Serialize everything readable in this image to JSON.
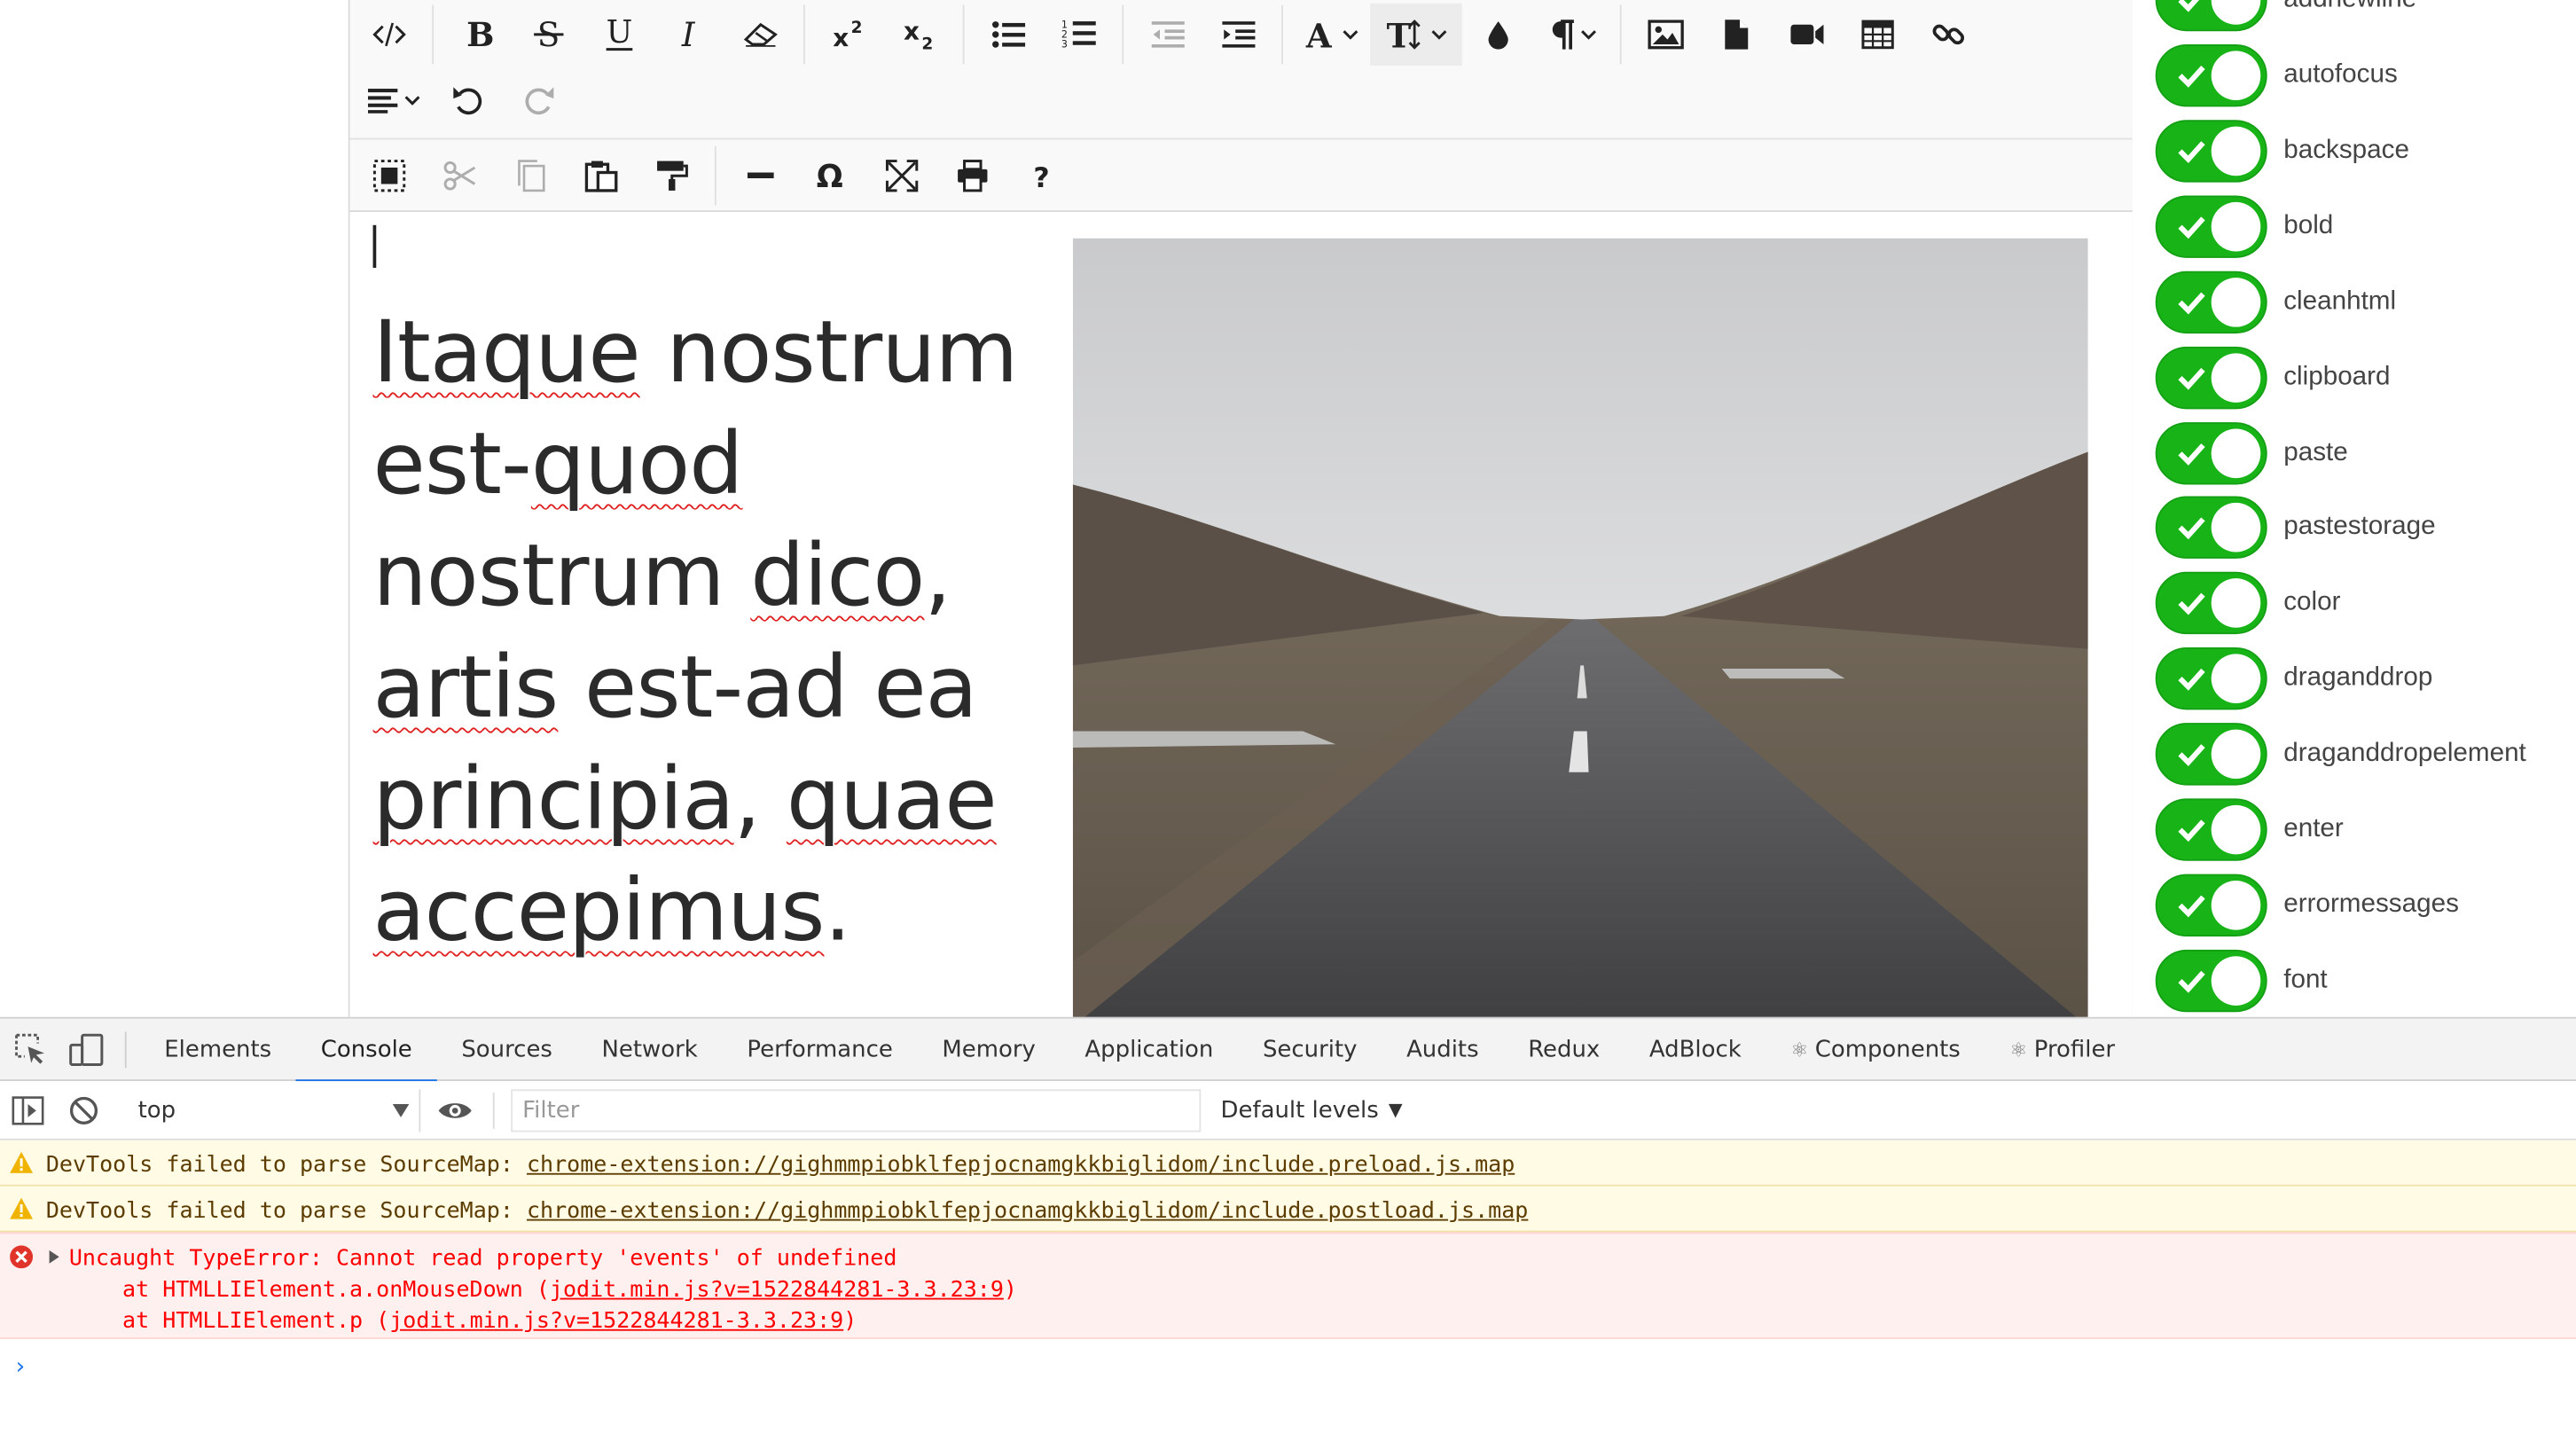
{
  "editor": {
    "toolbar": {
      "row1": [
        {
          "name": "source-icon"
        },
        {
          "name": "bold-icon"
        },
        {
          "name": "strikethrough-icon"
        },
        {
          "name": "underline-icon"
        },
        {
          "name": "italic-icon"
        },
        {
          "name": "eraser-icon"
        },
        {
          "name": "superscript-icon"
        },
        {
          "name": "subscript-icon"
        },
        {
          "name": "unordered-list-icon"
        },
        {
          "name": "ordered-list-icon"
        },
        {
          "name": "outdent-icon"
        },
        {
          "name": "indent-icon"
        },
        {
          "name": "font-icon"
        },
        {
          "name": "font-size-icon"
        },
        {
          "name": "brush-icon"
        },
        {
          "name": "paragraph-icon"
        },
        {
          "name": "image-icon"
        },
        {
          "name": "file-icon"
        },
        {
          "name": "video-icon"
        },
        {
          "name": "table-icon"
        },
        {
          "name": "link-icon"
        }
      ],
      "row2": [
        {
          "name": "align-icon"
        },
        {
          "name": "undo-icon"
        },
        {
          "name": "redo-icon"
        }
      ],
      "row3": [
        {
          "name": "select-all-icon"
        },
        {
          "name": "cut-icon"
        },
        {
          "name": "copy-icon"
        },
        {
          "name": "paste-icon"
        },
        {
          "name": "copy-format-icon"
        },
        {
          "name": "horizontal-rule-icon"
        },
        {
          "name": "symbol-icon"
        },
        {
          "name": "fullscreen-icon"
        },
        {
          "name": "print-icon"
        },
        {
          "name": "about-icon"
        }
      ]
    },
    "content": {
      "words": [
        "Itaque",
        " nostrum ",
        "est-",
        "quod",
        " nostrum ",
        "dico",
        ", ",
        "artis",
        " est-ad ea ",
        "principia",
        ", ",
        "quae",
        " ",
        "accepimus",
        "."
      ],
      "spellcheck": [
        true,
        false,
        false,
        true,
        false,
        true,
        false,
        true,
        false,
        true,
        false,
        true,
        false,
        true,
        false
      ]
    }
  },
  "plugins": {
    "items": [
      {
        "label": "autofocus",
        "enabled": true
      },
      {
        "label": "backspace",
        "enabled": true
      },
      {
        "label": "bold",
        "enabled": true
      },
      {
        "label": "cleanhtml",
        "enabled": true
      },
      {
        "label": "clipboard",
        "enabled": true
      },
      {
        "label": "paste",
        "enabled": true
      },
      {
        "label": "pastestorage",
        "enabled": true
      },
      {
        "label": "color",
        "enabled": true
      },
      {
        "label": "draganddrop",
        "enabled": true
      },
      {
        "label": "draganddropelement",
        "enabled": true
      },
      {
        "label": "enter",
        "enabled": true
      },
      {
        "label": "errormessages",
        "enabled": true
      },
      {
        "label": "font",
        "enabled": true
      }
    ],
    "partial_top_label": "addnewline"
  },
  "devtools": {
    "tabs": [
      "Elements",
      "Console",
      "Sources",
      "Network",
      "Performance",
      "Memory",
      "Application",
      "Security",
      "Audits",
      "Redux",
      "AdBlock",
      "Components",
      "Profiler"
    ],
    "react_tabs": [
      "Components",
      "Profiler"
    ],
    "selected_tab": "Console",
    "context": "top",
    "filter_placeholder": "Filter",
    "levels": "Default levels",
    "messages": [
      {
        "type": "warning",
        "text": "DevTools failed to parse SourceMap: ",
        "link": "chrome-extension://gighmmpiobklfepjocnamgkkbiglidom/include.preload.js.map"
      },
      {
        "type": "warning",
        "text": "DevTools failed to parse SourceMap: ",
        "link": "chrome-extension://gighmmpiobklfepjocnamgkkbiglidom/include.postload.js.map"
      },
      {
        "type": "error",
        "text": "Uncaught TypeError: Cannot read property 'events' of undefined",
        "trace": [
          {
            "prefix": "    at HTMLLIElement.a.onMouseDown (",
            "link": "jodit.min.js?v=1522844281-3.3.23:9",
            "suffix": ")"
          },
          {
            "prefix": "    at HTMLLIElement.p (",
            "link": "jodit.min.js?v=1522844281-3.3.23:9",
            "suffix": ")"
          }
        ]
      }
    ],
    "prompt": "›"
  },
  "colors": {
    "toggle_on": "#17b317",
    "tab_accent": "#1a73e8",
    "error_text": "#fe0000",
    "warning_bg": "#fffbe5",
    "error_bg": "#fff0f0"
  }
}
